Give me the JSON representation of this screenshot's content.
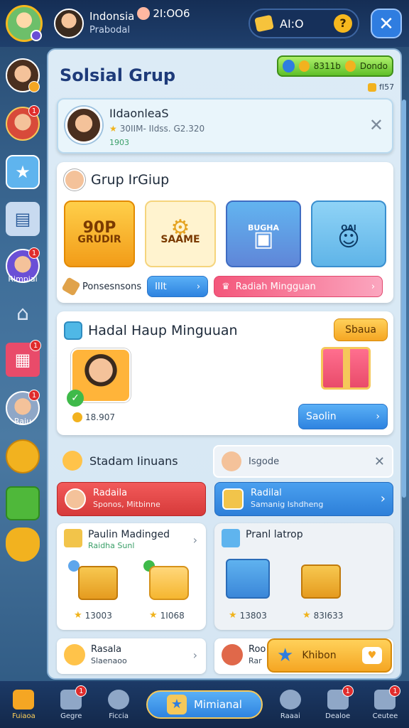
{
  "header": {
    "profile_name": "Indonsia",
    "profile_sub": "Prabodal",
    "time": "2I:OO6",
    "coins": "AI:O",
    "help_icon": "?",
    "close_icon": "✕"
  },
  "sidebar": {
    "items": [
      {
        "icon": "avatar-boy",
        "badge": ""
      },
      {
        "icon": "avatar-girl",
        "badge": "1"
      },
      {
        "icon": "star-icon",
        "badge": ""
      },
      {
        "icon": "document-icon",
        "badge": ""
      },
      {
        "icon": "avatar-helmet",
        "badge": "1",
        "label": "Rimpiai"
      },
      {
        "icon": "camera-icon",
        "badge": ""
      },
      {
        "icon": "gift-icon",
        "badge": "1"
      },
      {
        "icon": "avatar-kid",
        "badge": "1",
        "label": "Raiu"
      },
      {
        "icon": "coins-icon",
        "badge": ""
      },
      {
        "icon": "truck-icon",
        "badge": ""
      },
      {
        "icon": "pot-icon",
        "badge": ""
      }
    ]
  },
  "panel": {
    "title": "Solsial Grup",
    "top_pill_left": "8311b",
    "top_pill_right": "Dondo",
    "sub_pill": "fI57",
    "user_card": {
      "name": "IIdaonleaS",
      "stats": "30IIM- IIdss. G2.320",
      "sub": "1903",
      "close": "✕"
    },
    "grup": {
      "title": "Grup IrGiup",
      "tiles": [
        {
          "line1": "90P",
          "line2": "GRUDIR"
        },
        {
          "line1": "",
          "line2": "SAAME"
        },
        {
          "line1": "BUGHA",
          "line2": ""
        },
        {
          "line1": "OAI",
          "line2": ""
        }
      ],
      "footer_label": "Ponsesnsons",
      "blue_btn": "IIIt",
      "pink_btn": "Radiah Mingguan"
    },
    "hadiah": {
      "title": "Hadal Haup Minguuan",
      "orange_btn": "Sbaua",
      "count": "18.907",
      "blue_btn": "Saolin"
    },
    "stadam": {
      "title": "Stadam Iinuans",
      "search_text": "Isgode",
      "search_close": "✕"
    },
    "banners": [
      {
        "title": "Radaila",
        "sub": "Sponos, Mitbinne"
      },
      {
        "title": "Radilal",
        "sub": "Samanig Ishdheng"
      }
    ],
    "mini_cards": [
      {
        "title": "Paulin Madinged",
        "sub": "Raidha Sunl",
        "values": [
          "13003",
          "1I068"
        ]
      },
      {
        "title": "Pranl latrop",
        "sub": "",
        "values": [
          "13803",
          "83I633"
        ]
      }
    ],
    "bottom_cards": [
      {
        "title": "Rasala",
        "sub": "Slaenaoo"
      },
      {
        "title": "Roo",
        "sub": "Rar"
      }
    ],
    "float_btn": "Khibon"
  },
  "bottom_nav": [
    {
      "label": "Fuiaoa",
      "badge": ""
    },
    {
      "label": "Gegre",
      "badge": "1"
    },
    {
      "label": "Ficcia",
      "badge": ""
    },
    {
      "label": "Mimianal",
      "badge": ""
    },
    {
      "label": "Raaai",
      "badge": ""
    },
    {
      "label": "Dealoe",
      "badge": "1"
    },
    {
      "label": "Ceutee",
      "badge": "1"
    }
  ],
  "colors": {
    "accent_blue": "#2f7de0",
    "accent_orange": "#f5a623",
    "accent_red": "#e02c2c",
    "accent_green": "#5fbf29"
  }
}
